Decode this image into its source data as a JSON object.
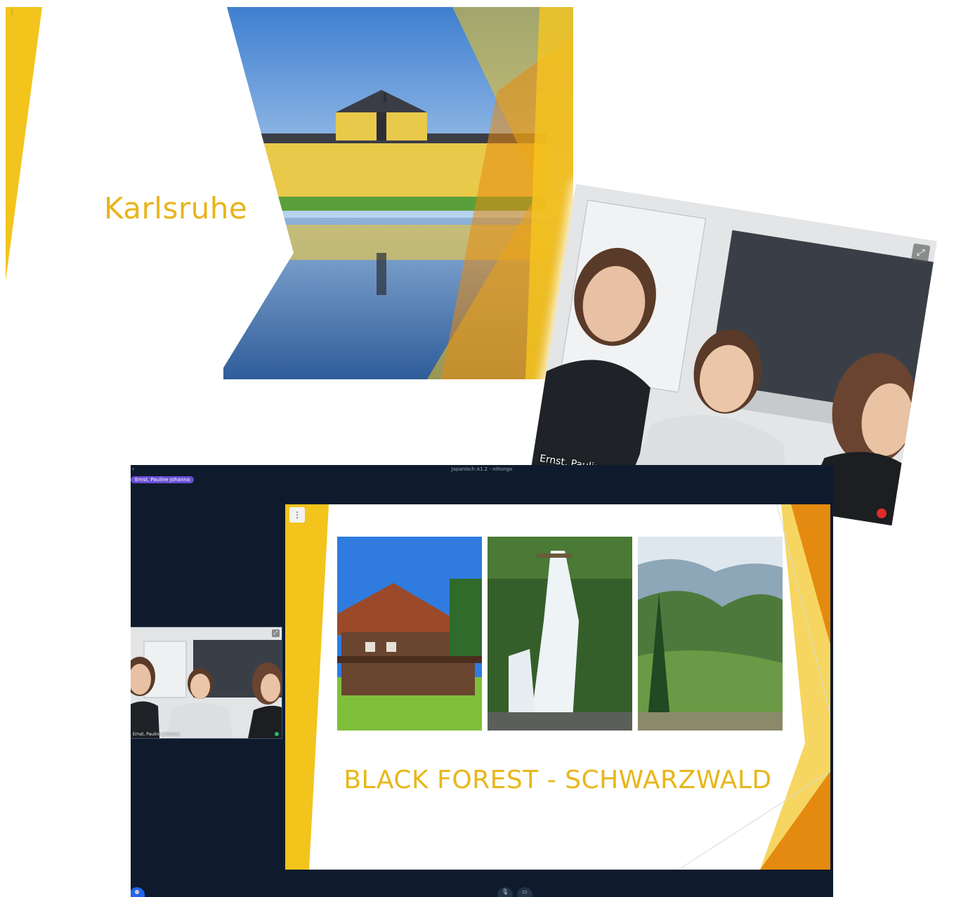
{
  "slide1": {
    "title": "Karlsruhe",
    "menu_icon": "⋮"
  },
  "webcam_big": {
    "name_label": "Ernst, Pauline Johanna",
    "expand_icon": "⤢"
  },
  "call": {
    "window_title": "Japanisch A1.2 - nihongo",
    "active_speaker": "Ernst, Pauline Johanna",
    "back_icon": "‹",
    "webcam_small": {
      "name_label": "Ernst, Pauline Johanna",
      "expand_icon": "⤢"
    },
    "controls": {
      "chat_icon": "●",
      "mic_icon": "🎙",
      "camera_icon": "▭"
    }
  },
  "slide2": {
    "title": "BLACK FOREST - SCHWARZWALD",
    "menu_icon": "⋮",
    "photos": [
      "farmhouse",
      "waterfall",
      "valley"
    ]
  },
  "colors": {
    "accent_yellow": "#e8b41a",
    "accent_orange": "#e58a10",
    "call_background": "#0f1b2d"
  }
}
